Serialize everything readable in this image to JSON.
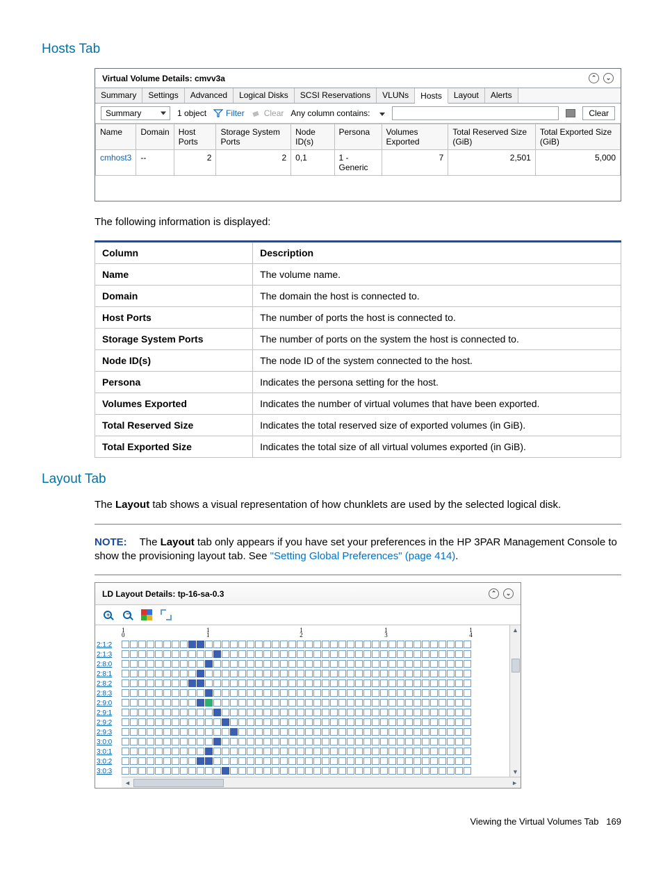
{
  "sections": {
    "hosts_title": "Hosts Tab",
    "layout_title": "Layout Tab"
  },
  "panel1": {
    "title_prefix": "Virtual Volume Details: ",
    "title_name": "cmvv3a",
    "tabs": [
      "Summary",
      "Settings",
      "Advanced",
      "Logical Disks",
      "SCSI Reservations",
      "VLUNs",
      "Hosts",
      "Layout",
      "Alerts"
    ],
    "active_tab_index": 6,
    "toolbar": {
      "view_dd": "Summary",
      "count": "1 object",
      "filter": "Filter",
      "clear_link": "Clear",
      "anycol": "Any column contains:",
      "clear_btn": "Clear"
    },
    "columns": [
      "Name",
      "Domain",
      "Host Ports",
      "Storage System Ports",
      "Node ID(s)",
      "Persona",
      "Volumes Exported",
      "Total Reserved Size (GiB)",
      "Total Exported Size (GiB)"
    ],
    "row": {
      "name": "cmhost3",
      "domain": "--",
      "host_ports": "2",
      "ssp": "2",
      "node_ids": "0,1",
      "persona": "1 - Generic",
      "vol_exp": "7",
      "tot_res": "2,501",
      "tot_exp": "5,000"
    }
  },
  "info_line": "The following information is displayed:",
  "desc_headers": {
    "col": "Column",
    "desc": "Description"
  },
  "desc_rows": [
    {
      "k": "Name",
      "v": "The volume name."
    },
    {
      "k": "Domain",
      "v": "The domain the host is connected to."
    },
    {
      "k": "Host Ports",
      "v": "The number of ports the host is connected to."
    },
    {
      "k": "Storage System Ports",
      "v": "The number of ports on the system the host is connected to."
    },
    {
      "k": "Node ID(s)",
      "v": "The node ID of the system connected to the host."
    },
    {
      "k": "Persona",
      "v": "Indicates the persona setting for the host."
    },
    {
      "k": "Volumes Exported",
      "v": "Indicates the number of virtual volumes that have been exported."
    },
    {
      "k": "Total Reserved Size",
      "v": "Indicates the total reserved size of exported volumes (in GiB)."
    },
    {
      "k": "Total Exported Size",
      "v": "Indicates the total size of all virtual volumes exported (in GiB)."
    }
  ],
  "layout_para1a": "The ",
  "layout_para1b": "Layout",
  "layout_para1c": " tab shows a visual representation of how chunklets are used by the selected logical disk.",
  "note_label": "NOTE:",
  "note_a": "The ",
  "note_b": "Layout",
  "note_c": " tab only appears if you have set your preferences in the HP 3PAR Management Console to show the provisioning layout tab. See ",
  "note_link": "\"Setting Global Preferences\" (page 414)",
  "note_d": ".",
  "ld": {
    "title_prefix": "LD Layout Details: ",
    "title_name": "tp-16-sa-0.3",
    "row_labels": [
      "2:1:2",
      "2:1:3",
      "2:8:0",
      "2:8:1",
      "2:8:2",
      "2:8:3",
      "2:9:0",
      "2:9:1",
      "2:9:2",
      "2:9:3",
      "3:0:0",
      "3:0:1",
      "3:0:2",
      "3:0:3"
    ],
    "cols": 42,
    "filled": {
      "0": [
        8,
        9
      ],
      "4": [
        8,
        9
      ],
      "1": [
        11
      ],
      "2": [
        10
      ],
      "3": [
        9
      ],
      "5": [
        10
      ],
      "6": [
        9
      ],
      "7": [
        11
      ],
      "8": [
        12
      ],
      "9": [
        13
      ],
      "10": [
        11
      ],
      "11": [
        10
      ],
      "12": [
        9,
        10
      ],
      "13": [
        12
      ]
    },
    "green": {
      "6": [
        10
      ]
    }
  },
  "chart_data": {
    "type": "heatmap",
    "title": "LD Layout Details: tp-16-sa-0.3",
    "row_labels": [
      "2:1:2",
      "2:1:3",
      "2:8:0",
      "2:8:1",
      "2:8:2",
      "2:8:3",
      "2:9:0",
      "2:9:1",
      "2:9:2",
      "2:9:3",
      "3:0:0",
      "3:0:1",
      "3:0:2",
      "3:0:3"
    ],
    "x_ticks": [
      {
        "label": "1/0",
        "pos": 0
      },
      {
        "label": "1/1",
        "pos": 10
      },
      {
        "label": "1/2",
        "pos": 21
      },
      {
        "label": "1/3",
        "pos": 31
      },
      {
        "label": "1/4",
        "pos": 41
      }
    ],
    "n_cols": 42,
    "cells": [
      {
        "row": "2:1:2",
        "cols": [
          8,
          9
        ],
        "color": "blue"
      },
      {
        "row": "2:1:3",
        "cols": [
          11
        ],
        "color": "blue"
      },
      {
        "row": "2:8:0",
        "cols": [
          10
        ],
        "color": "blue"
      },
      {
        "row": "2:8:1",
        "cols": [
          9
        ],
        "color": "blue"
      },
      {
        "row": "2:8:2",
        "cols": [
          8,
          9
        ],
        "color": "blue"
      },
      {
        "row": "2:8:3",
        "cols": [
          10
        ],
        "color": "blue"
      },
      {
        "row": "2:9:0",
        "cols": [
          9
        ],
        "color": "blue"
      },
      {
        "row": "2:9:0",
        "cols": [
          10
        ],
        "color": "green"
      },
      {
        "row": "2:9:1",
        "cols": [
          11
        ],
        "color": "blue"
      },
      {
        "row": "2:9:2",
        "cols": [
          12
        ],
        "color": "blue"
      },
      {
        "row": "2:9:3",
        "cols": [
          13
        ],
        "color": "blue"
      },
      {
        "row": "3:0:0",
        "cols": [
          11
        ],
        "color": "blue"
      },
      {
        "row": "3:0:1",
        "cols": [
          10
        ],
        "color": "blue"
      },
      {
        "row": "3:0:2",
        "cols": [
          9,
          10
        ],
        "color": "blue"
      },
      {
        "row": "3:0:3",
        "cols": [
          12
        ],
        "color": "blue"
      }
    ]
  },
  "footer": {
    "text": "Viewing the Virtual Volumes Tab",
    "page": "169"
  }
}
